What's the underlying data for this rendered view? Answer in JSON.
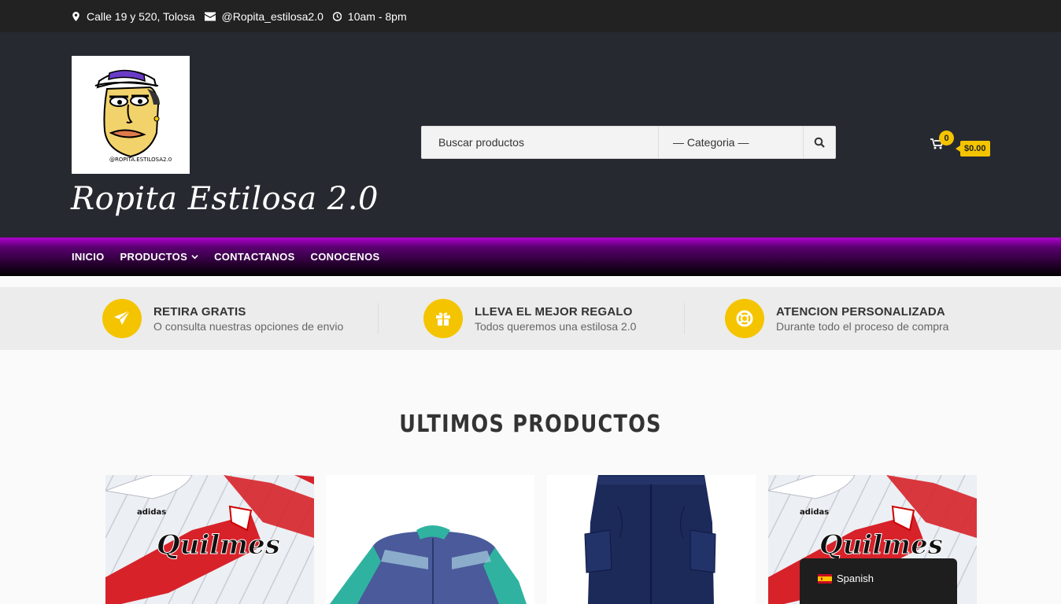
{
  "topbar": {
    "address": "Calle 19 y 520, Tolosa",
    "email": "@Ropita_estilosa2.0",
    "hours": "10am - 8pm"
  },
  "header": {
    "site_title": "Ropita Estilosa 2.0",
    "logo_text": "@ROPITA.ESTILOSA2.0",
    "search": {
      "placeholder": "Buscar productos",
      "category_label": "— Categoria —"
    },
    "cart": {
      "count": "0",
      "total": "$0.00"
    }
  },
  "nav": {
    "items": [
      "INICIO",
      "PRODUCTOS",
      "CONTACTANOS",
      "CONOCENOS"
    ]
  },
  "features": [
    {
      "title": "RETIRA GRATIS",
      "subtitle": "O consulta nuestras opciones de envio",
      "icon": "paper-plane-icon"
    },
    {
      "title": "LLEVA EL MEJOR REGALO",
      "subtitle": "Todos queremos una estilosa 2.0",
      "icon": "gift-icon"
    },
    {
      "title": "ATENCION PERSONALIZADA",
      "subtitle": "Durante todo el proceso de compra",
      "icon": "life-ring-icon"
    }
  ],
  "products_section": {
    "title": "ULTIMOS PRODUCTOS",
    "jersey_sponsor": "Quilmes",
    "jersey_brand": "adidas"
  },
  "language": {
    "label": "Spanish"
  },
  "colors": {
    "accent": "#f5c400",
    "topbar": "#222222",
    "header": "#262930",
    "nav_gradient_top": "#b000d0"
  }
}
